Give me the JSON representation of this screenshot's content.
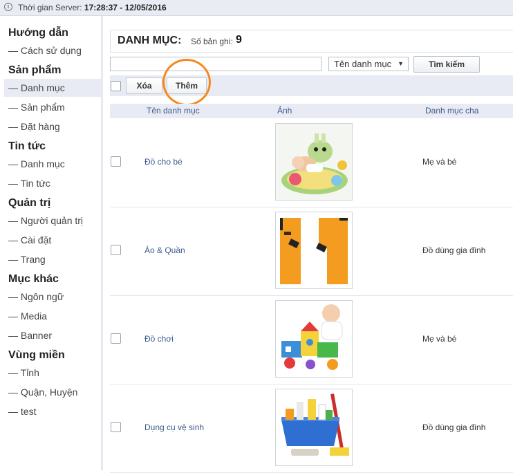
{
  "server": {
    "label": "Thời gian Server: ",
    "value": "17:28:37 - 12/05/2016"
  },
  "sidebar": {
    "sections": [
      {
        "title": "Hướng dẫn",
        "items": [
          "— Cách sử dụng"
        ]
      },
      {
        "title": "Sản phẩm",
        "items": [
          "— Danh mục",
          "— Sản phẩm",
          "— Đặt hàng"
        ]
      },
      {
        "title": "Tin tức",
        "items": [
          "— Danh mục",
          "— Tin tức"
        ]
      },
      {
        "title": "Quản trị",
        "items": [
          "— Người quản trị",
          "— Cài đặt",
          "— Trang"
        ]
      },
      {
        "title": "Mục khác",
        "items": [
          "— Ngôn ngữ",
          "— Media",
          "— Banner"
        ]
      },
      {
        "title": "Vùng miền",
        "items": [
          "— Tỉnh",
          "— Quận, Huyện",
          "— test"
        ]
      }
    ],
    "active_item": "Sản phẩm / Danh mục"
  },
  "main": {
    "title": "DANH MỤC:",
    "count_label": "Số bản ghi:",
    "count_value": "9",
    "search": {
      "value": "",
      "placeholder": ""
    },
    "filter_select": "Tên danh mục",
    "search_button": "Tìm kiếm",
    "delete_button": "Xóa",
    "add_button": "Thêm",
    "columns": [
      "Tên danh mục",
      "Ảnh",
      "Danh mục cha"
    ],
    "rows": [
      {
        "name": "Đồ cho bé",
        "image": "baby-on-play-mat-image",
        "parent": "Mẹ và bé"
      },
      {
        "name": "Áo & Quần",
        "image": "orange-shirt-image",
        "parent": "Đồ dùng gia đình"
      },
      {
        "name": "Đồ chơi",
        "image": "toddler-with-toys-image",
        "parent": "Mẹ và bé"
      },
      {
        "name": "Dụng cụ vệ sinh",
        "image": "cleaning-supplies-image",
        "parent": "Đồ dùng gia đình"
      }
    ]
  },
  "colors": {
    "accent_ring": "#f5891f",
    "link_text": "#3d5a8a",
    "header_bg": "#e8ebf3"
  }
}
